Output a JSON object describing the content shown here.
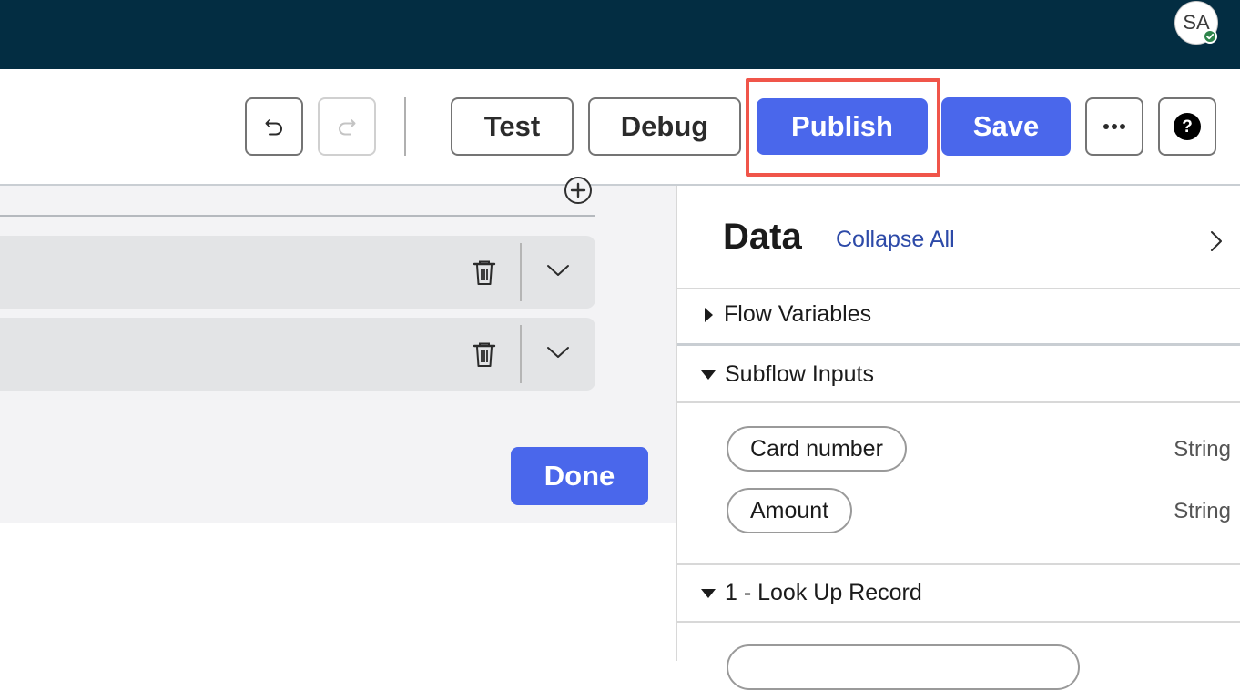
{
  "header": {
    "avatar_initials": "SA",
    "avatar_status": "online"
  },
  "toolbar": {
    "undo_icon": "undo-icon",
    "redo_icon": "redo-icon",
    "test_label": "Test",
    "debug_label": "Debug",
    "publish_label": "Publish",
    "save_label": "Save",
    "more_icon": "ellipsis-icon",
    "help_icon": "help-icon"
  },
  "canvas": {
    "done_label": "Done"
  },
  "data_panel": {
    "title": "Data",
    "collapse_all_label": "Collapse All",
    "sections": [
      {
        "label": "Flow Variables",
        "expanded": false
      },
      {
        "label": "Subflow Inputs",
        "expanded": true
      },
      {
        "label": "1 - Look Up Record",
        "expanded": true
      }
    ],
    "inputs": [
      {
        "name": "Card number",
        "type": "String"
      },
      {
        "name": "Amount",
        "type": "String"
      }
    ]
  },
  "colors": {
    "header_bg": "#032d42",
    "primary": "#4a67eb",
    "highlight": "#f0554a",
    "link": "#2d4aa8"
  }
}
